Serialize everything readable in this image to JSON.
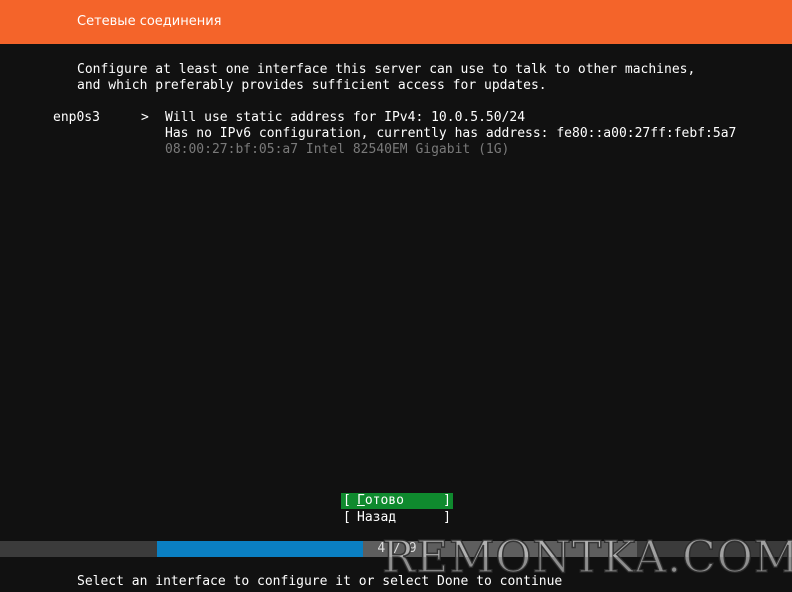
{
  "header": {
    "title": "Сетевые соединения"
  },
  "intro": {
    "line1": "Configure at least one interface this server can use to talk to other machines,",
    "line2": "and which preferably provides sufficient access for updates."
  },
  "interface": {
    "name": "enp0s3",
    "arrow": ">",
    "ipv4": "Will use static address for IPv4: 10.0.5.50/24",
    "ipv6": "Has no IPv6 configuration, currently has address: fe80::a00:27ff:febf:5a7",
    "hardware": "08:00:27:bf:05:a7 Intel 82540EM Gigabit (1G)"
  },
  "buttons": {
    "bracket_left": "[",
    "bracket_right": "]",
    "done_first": "Г",
    "done_rest": "отово",
    "back": "Назад"
  },
  "progress": {
    "text": "4 / 9",
    "fraction": 0.43
  },
  "status": {
    "text": "Select an interface to configure it or select Done to continue"
  },
  "watermark": {
    "text": "REMONTKA.COM"
  },
  "colors": {
    "header_bg": "#f4642a",
    "done_bg": "#0f8a2e",
    "progress_fill": "#0a7fc2"
  }
}
